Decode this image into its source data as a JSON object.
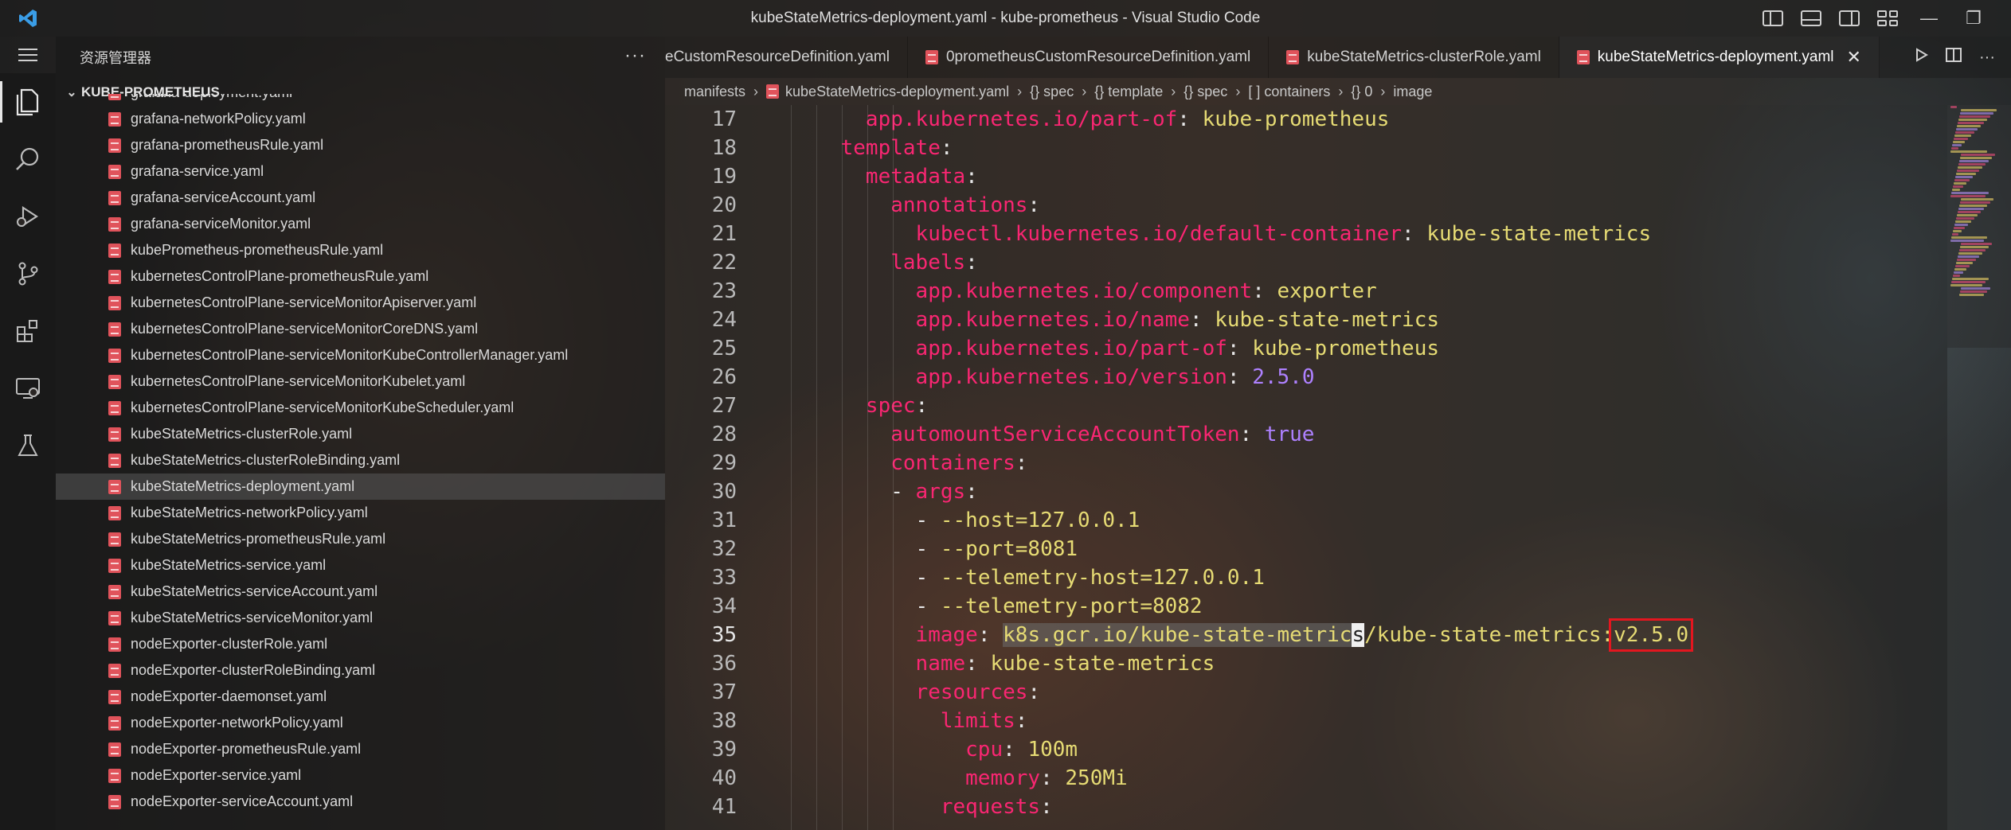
{
  "window": {
    "title": "kubeStateMetrics-deployment.yaml - kube-prometheus - Visual Studio Code",
    "minimize": "—",
    "restore": "❐"
  },
  "sidebar": {
    "header": "资源管理器",
    "more": "···",
    "section": "KUBE-PROMETHEUS",
    "files": [
      "grafana-deployment.yaml",
      "grafana-networkPolicy.yaml",
      "grafana-prometheusRule.yaml",
      "grafana-service.yaml",
      "grafana-serviceAccount.yaml",
      "grafana-serviceMonitor.yaml",
      "kubePrometheus-prometheusRule.yaml",
      "kubernetesControlPlane-prometheusRule.yaml",
      "kubernetesControlPlane-serviceMonitorApiserver.yaml",
      "kubernetesControlPlane-serviceMonitorCoreDNS.yaml",
      "kubernetesControlPlane-serviceMonitorKubeControllerManager.yaml",
      "kubernetesControlPlane-serviceMonitorKubelet.yaml",
      "kubernetesControlPlane-serviceMonitorKubeScheduler.yaml",
      "kubeStateMetrics-clusterRole.yaml",
      "kubeStateMetrics-clusterRoleBinding.yaml",
      "kubeStateMetrics-deployment.yaml",
      "kubeStateMetrics-networkPolicy.yaml",
      "kubeStateMetrics-prometheusRule.yaml",
      "kubeStateMetrics-service.yaml",
      "kubeStateMetrics-serviceAccount.yaml",
      "kubeStateMetrics-serviceMonitor.yaml",
      "nodeExporter-clusterRole.yaml",
      "nodeExporter-clusterRoleBinding.yaml",
      "nodeExporter-daemonset.yaml",
      "nodeExporter-networkPolicy.yaml",
      "nodeExporter-prometheusRule.yaml",
      "nodeExporter-service.yaml",
      "nodeExporter-serviceAccount.yaml"
    ],
    "selected_file": "kubeStateMetrics-deployment.yaml"
  },
  "tabs": [
    {
      "label": "eCustomResourceDefinition.yaml"
    },
    {
      "label": "0prometheusCustomResourceDefinition.yaml"
    },
    {
      "label": "kubeStateMetrics-clusterRole.yaml"
    },
    {
      "label": "kubeStateMetrics-deployment.yaml",
      "close": "✕"
    }
  ],
  "breadcrumb": {
    "items": [
      "manifests",
      "kubeStateMetrics-deployment.yaml",
      "{} spec",
      "{} template",
      "{} spec",
      "[ ] containers",
      "{} 0",
      "image"
    ]
  },
  "editor": {
    "current_line": "35",
    "lines": [
      {
        "num": "17",
        "indent": "      ",
        "key": "app.kubernetes.io/part-of",
        "sep": ": ",
        "val": "kube-prometheus",
        "vtype": "s"
      },
      {
        "num": "18",
        "indent": "    ",
        "key": "template",
        "sep": ":",
        "val": "",
        "vtype": "s"
      },
      {
        "num": "19",
        "indent": "      ",
        "key": "metadata",
        "sep": ":",
        "val": "",
        "vtype": "s"
      },
      {
        "num": "20",
        "indent": "        ",
        "key": "annotations",
        "sep": ":",
        "val": "",
        "vtype": "s"
      },
      {
        "num": "21",
        "indent": "          ",
        "key": "kubectl.kubernetes.io/default-container",
        "sep": ": ",
        "val": "kube-state-metrics",
        "vtype": "s"
      },
      {
        "num": "22",
        "indent": "        ",
        "key": "labels",
        "sep": ":",
        "val": "",
        "vtype": "s"
      },
      {
        "num": "23",
        "indent": "          ",
        "key": "app.kubernetes.io/component",
        "sep": ": ",
        "val": "exporter",
        "vtype": "s"
      },
      {
        "num": "24",
        "indent": "          ",
        "key": "app.kubernetes.io/name",
        "sep": ": ",
        "val": "kube-state-metrics",
        "vtype": "s"
      },
      {
        "num": "25",
        "indent": "          ",
        "key": "app.kubernetes.io/part-of",
        "sep": ": ",
        "val": "kube-prometheus",
        "vtype": "s"
      },
      {
        "num": "26",
        "indent": "          ",
        "key": "app.kubernetes.io/version",
        "sep": ": ",
        "val": "2.5.0",
        "vtype": "n"
      },
      {
        "num": "27",
        "indent": "      ",
        "key": "spec",
        "sep": ":",
        "val": "",
        "vtype": "s"
      },
      {
        "num": "28",
        "indent": "        ",
        "key": "automountServiceAccountToken",
        "sep": ": ",
        "val": "true",
        "vtype": "n"
      },
      {
        "num": "29",
        "indent": "        ",
        "key": "containers",
        "sep": ":",
        "val": "",
        "vtype": "s"
      },
      {
        "num": "30",
        "indent": "        ",
        "dash": "- ",
        "key": "args",
        "sep": ":",
        "val": "",
        "vtype": "s"
      },
      {
        "num": "31",
        "indent": "          ",
        "dash": "- ",
        "key": "",
        "sep": "",
        "val": "--host=127.0.0.1",
        "vtype": "s"
      },
      {
        "num": "32",
        "indent": "          ",
        "dash": "- ",
        "key": "",
        "sep": "",
        "val": "--port=8081",
        "vtype": "s"
      },
      {
        "num": "33",
        "indent": "          ",
        "dash": "- ",
        "key": "",
        "sep": "",
        "val": "--telemetry-host=127.0.0.1",
        "vtype": "s"
      },
      {
        "num": "34",
        "indent": "          ",
        "dash": "- ",
        "key": "",
        "sep": "",
        "val": "--telemetry-port=8082",
        "vtype": "s"
      },
      {
        "num": "35",
        "indent": "          ",
        "key": "image",
        "sep": ": ",
        "special": "image",
        "vtype": "s"
      },
      {
        "num": "36",
        "indent": "          ",
        "key": "name",
        "sep": ": ",
        "val": "kube-state-metrics",
        "vtype": "s"
      },
      {
        "num": "37",
        "indent": "          ",
        "key": "resources",
        "sep": ":",
        "val": "",
        "vtype": "s"
      },
      {
        "num": "38",
        "indent": "            ",
        "key": "limits",
        "sep": ":",
        "val": "",
        "vtype": "s"
      },
      {
        "num": "39",
        "indent": "              ",
        "key": "cpu",
        "sep": ": ",
        "val": "100m",
        "vtype": "s"
      },
      {
        "num": "40",
        "indent": "              ",
        "key": "memory",
        "sep": ": ",
        "val": "250Mi",
        "vtype": "s"
      },
      {
        "num": "41",
        "indent": "            ",
        "key": "requests",
        "sep": ":",
        "val": "",
        "vtype": "s"
      }
    ],
    "image_value": {
      "highlighted": "k8s.gcr.io/kube-state-metric",
      "cursor_char": "s",
      "rest": "/kube-state-metrics:",
      "tag": "v2.5.0"
    }
  },
  "colors": {
    "key": "#f92672",
    "string": "#e6db74",
    "number": "#ae81ff",
    "annotation_box": "#e3161f",
    "yaml_file_icon": "#e0535b",
    "vscode_blue": "#3a9de6"
  }
}
